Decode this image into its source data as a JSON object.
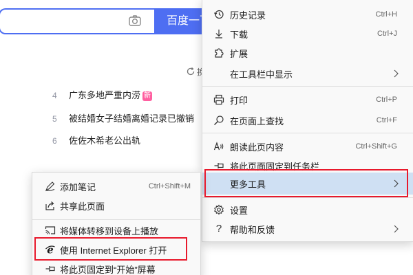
{
  "search": {
    "button_label": "百度一下",
    "icon": "camera-icon"
  },
  "refresh": {
    "text": "换"
  },
  "hot_list": [
    {
      "num": "4",
      "text": "广东多地严重内涝",
      "badge": "新"
    },
    {
      "num": "5",
      "text": "被结婚女子结婚离婚记录已撤销",
      "badge": ""
    },
    {
      "num": "6",
      "text": "佐佐木希老公出轨",
      "badge": ""
    }
  ],
  "main_menu": {
    "items": [
      {
        "label": "历史记录",
        "shortcut": "Ctrl+H",
        "icon": "history-icon"
      },
      {
        "label": "下载",
        "shortcut": "Ctrl+J",
        "icon": "download-icon"
      },
      {
        "label": "扩展",
        "shortcut": "",
        "icon": "extensions-icon"
      },
      {
        "label": "在工具栏中显示",
        "shortcut": "",
        "icon": ""
      },
      {
        "label": "打印",
        "shortcut": "Ctrl+P",
        "icon": "print-icon"
      },
      {
        "label": "在页面上查找",
        "shortcut": "Ctrl+F",
        "icon": "find-icon"
      },
      {
        "label": "朗读此页内容",
        "shortcut": "Ctrl+Shift+G",
        "icon": "read-aloud-icon"
      },
      {
        "label": "将此页面固定到任务栏",
        "shortcut": "",
        "icon": "pin-taskbar-icon"
      },
      {
        "label": "更多工具",
        "shortcut": "",
        "icon": ""
      },
      {
        "label": "设置",
        "shortcut": "",
        "icon": "settings-icon"
      },
      {
        "label": "帮助和反馈",
        "shortcut": "",
        "icon": "help-icon"
      }
    ],
    "highlighted": "更多工具"
  },
  "sub_menu": {
    "items": [
      {
        "label": "添加笔记",
        "shortcut": "Ctrl+Shift+M",
        "icon": "pen-icon"
      },
      {
        "label": "共享此页面",
        "shortcut": "",
        "icon": "share-icon"
      },
      {
        "label": "将媒体转移到设备上播放",
        "shortcut": "",
        "icon": "cast-icon"
      },
      {
        "label": "使用 Internet Explorer 打开",
        "shortcut": "",
        "icon": "ie-icon"
      },
      {
        "label": "将此页固定到“开始”屏幕",
        "shortcut": "",
        "icon": "pin-start-icon"
      }
    ]
  },
  "colors": {
    "brand_blue": "#4e6ef2",
    "highlight": "#cfe0f3",
    "annotation_red": "#e8192c",
    "badge_pink": "#ff5fa0"
  }
}
